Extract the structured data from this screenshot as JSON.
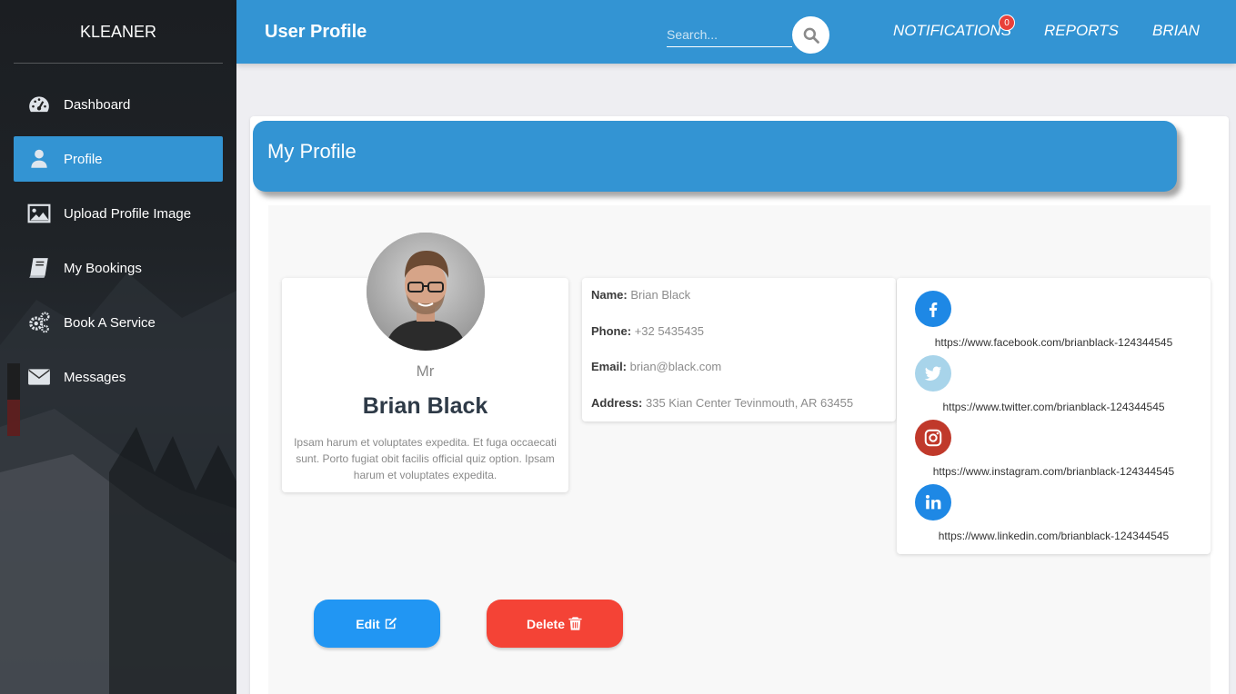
{
  "sidebar": {
    "brand": "KLEANER",
    "items": [
      {
        "label": "Dashboard",
        "icon": "dashboard-gauge-icon",
        "active": false
      },
      {
        "label": "Profile",
        "icon": "user-icon",
        "active": true
      },
      {
        "label": "Upload Profile Image",
        "icon": "image-icon",
        "active": false
      },
      {
        "label": "My Bookings",
        "icon": "book-icon",
        "active": false
      },
      {
        "label": "Book A Service",
        "icon": "cogs-icon",
        "active": false
      },
      {
        "label": "Messages",
        "icon": "envelope-icon",
        "active": false
      }
    ]
  },
  "topbar": {
    "title": "User Profile",
    "search_placeholder": "Search...",
    "links": {
      "notifications": "NOTIFICATIONS",
      "reports": "REPORTS",
      "user": "BRIAN"
    },
    "notification_count": "0"
  },
  "card": {
    "header": "My Profile"
  },
  "profile": {
    "honorific": "Mr",
    "name": "Brian Black",
    "bio": "Ipsam harum et voluptates expedita. Et fuga occaecati sunt. Porto fugiat obit facilis official quiz option. Ipsam harum et voluptates expedita."
  },
  "info": {
    "name_label": "Name:",
    "name_value": "Brian Black",
    "phone_label": "Phone:",
    "phone_value": "+32 5435435",
    "email_label": "Email:",
    "email_value": "brian@black.com",
    "address_label": "Address:",
    "address_value": "335 Kian Center Tevinmouth, AR 63455"
  },
  "social": {
    "facebook": "https://www.facebook.com/brianblack-124344545",
    "twitter": "https://www.twitter.com/brianblack-124344545",
    "instagram": "https://www.instagram.com/brianblack-124344545",
    "linkedin": "https://www.linkedin.com/brianblack-124344545"
  },
  "actions": {
    "edit": "Edit",
    "delete": "Delete"
  },
  "colors": {
    "primary": "#3394d3",
    "edit": "#2196f3",
    "delete": "#f44336",
    "facebook": "#1e88e5",
    "twitter": "#a8d4ea",
    "instagram": "#c0392b",
    "linkedin": "#1e88e5"
  }
}
